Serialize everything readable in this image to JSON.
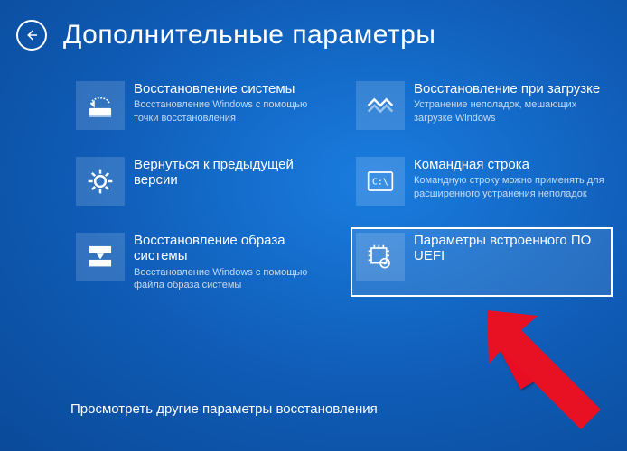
{
  "header": {
    "title": "Дополнительные параметры"
  },
  "tiles": [
    {
      "id": "system-restore",
      "title": "Восстановление системы",
      "desc": "Восстановление Windows с помощью точки восстановления"
    },
    {
      "id": "startup-repair",
      "title": "Восстановление при загрузке",
      "desc": "Устранение неполадок, мешающих загрузке Windows"
    },
    {
      "id": "go-back",
      "title": "Вернуться к предыдущей версии",
      "desc": ""
    },
    {
      "id": "command-prompt",
      "title": "Командная строка",
      "desc": "Командную строку можно применять для расширенного устранения неполадок"
    },
    {
      "id": "image-recovery",
      "title": "Восстановление образа системы",
      "desc": "Восстановление Windows с помощью файла образа системы"
    },
    {
      "id": "uefi-settings",
      "title": "Параметры встроенного ПО UEFI",
      "desc": ""
    }
  ],
  "footer": {
    "more": "Просмотреть другие параметры восстановления"
  }
}
